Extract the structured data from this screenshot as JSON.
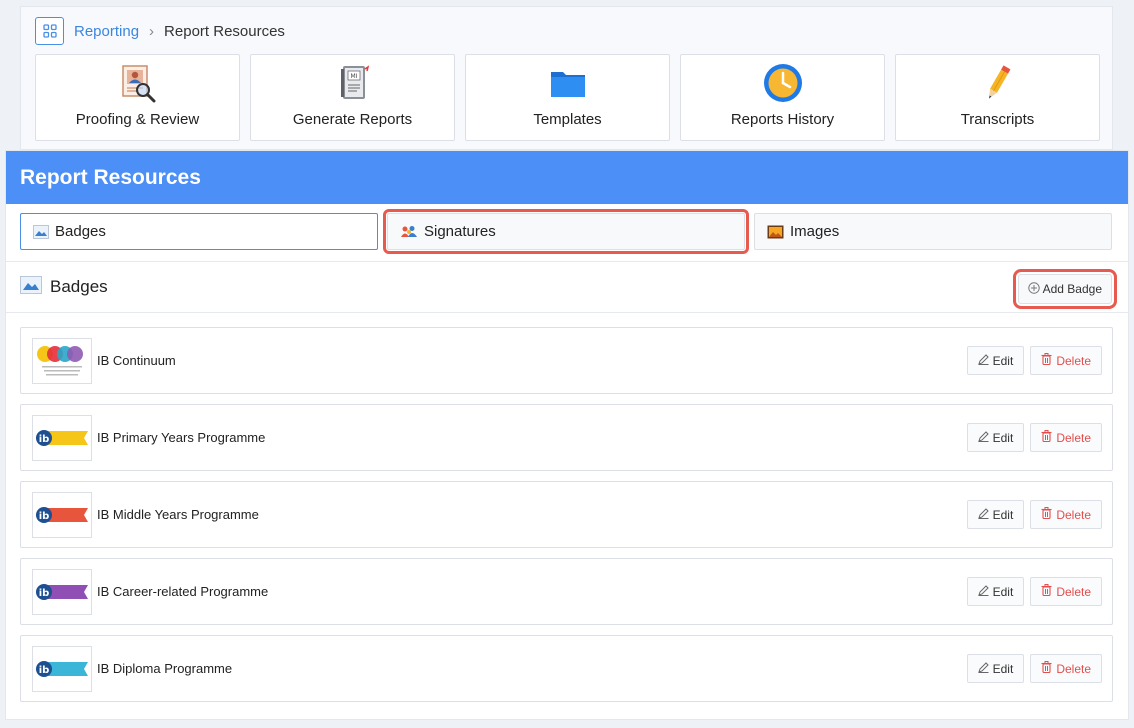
{
  "breadcrumb": {
    "icon": "grid-icon",
    "parent": "Reporting",
    "separator": "›",
    "current": "Report Resources"
  },
  "nav_tiles": [
    {
      "label": "Proofing & Review",
      "icon": "proofing-icon"
    },
    {
      "label": "Generate Reports",
      "icon": "report-cards-icon"
    },
    {
      "label": "Templates",
      "icon": "folder-icon"
    },
    {
      "label": "Reports History",
      "icon": "clock-icon"
    },
    {
      "label": "Transcripts",
      "icon": "pencil-icon"
    }
  ],
  "panel": {
    "title": "Report Resources",
    "tabs": [
      {
        "label": "Badges",
        "icon": "badge-icon",
        "active": true
      },
      {
        "label": "Signatures",
        "icon": "people-icon",
        "highlighted": true
      },
      {
        "label": "Images",
        "icon": "image-icon"
      }
    ],
    "section_title": "Badges",
    "add_button": "Add Badge"
  },
  "badges": [
    {
      "name": "IB Continuum",
      "thumb": "ib-continuum-logo"
    },
    {
      "name": "IB Primary Years Programme",
      "thumb": "ib-pyp-logo"
    },
    {
      "name": "IB Middle Years Programme",
      "thumb": "ib-myp-logo"
    },
    {
      "name": "IB Career-related Programme",
      "thumb": "ib-cp-logo"
    },
    {
      "name": "IB Diploma Programme",
      "thumb": "ib-dp-logo"
    }
  ],
  "row_actions": {
    "edit": "Edit",
    "delete": "Delete"
  },
  "colors": {
    "header": "#4b8ff7",
    "highlight": "#e65a4f",
    "delete": "#e44d4d",
    "link": "#3d86df"
  }
}
